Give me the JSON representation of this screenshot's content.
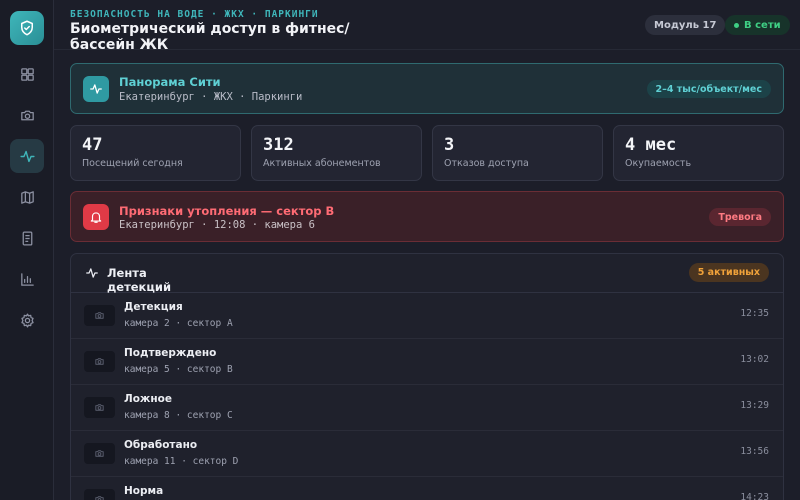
{
  "header": {
    "eyebrow": "БЕЗОПАСНОСТЬ НА ВОДЕ · ЖКХ · ПАРКИНГИ",
    "title": "Биометрический доступ в фитнес/бассейн ЖК",
    "module": "Модуль 17",
    "status": "В сети"
  },
  "sidebar": {
    "logo_icon": "shield-check-icon",
    "items": [
      {
        "icon": "dashboard-grid-icon",
        "active": false
      },
      {
        "icon": "camera-icon",
        "active": false
      },
      {
        "icon": "pulse-icon",
        "active": true
      },
      {
        "icon": "map-icon",
        "active": false
      },
      {
        "icon": "document-icon",
        "active": false
      },
      {
        "icon": "bar-chart-icon",
        "active": false
      },
      {
        "icon": "gear-icon",
        "active": false
      }
    ]
  },
  "site": {
    "name": "Панорама Сити",
    "meta": "Екатеринбург · ЖКХ · Паркинги",
    "price": "2–4 тыс/объект/мес"
  },
  "stats": [
    {
      "value": "47",
      "label": "Посещений сегодня"
    },
    {
      "value": "312",
      "label": "Активных абонементов"
    },
    {
      "value": "3",
      "label": "Отказов доступа"
    },
    {
      "value": "4 мес",
      "label": "Окупаемость"
    }
  ],
  "alert": {
    "title": "Признаки утопления — сектор B",
    "meta": "Екатеринбург · 12:08 · камера 6",
    "badge": "Тревога"
  },
  "feed": {
    "title": "Лента детекций",
    "count": "5 активных",
    "items": [
      {
        "status": "Детекция",
        "meta": "камера 2 · сектор A",
        "time": "12:35"
      },
      {
        "status": "Подтверждено",
        "meta": "камера 5 · сектор B",
        "time": "13:02"
      },
      {
        "status": "Ложное",
        "meta": "камера 8 · сектор C",
        "time": "13:29"
      },
      {
        "status": "Обработано",
        "meta": "камера 11 · сектор D",
        "time": "13:56"
      },
      {
        "status": "Норма",
        "meta": "",
        "time": "14:23"
      }
    ]
  },
  "colors": {
    "accent": "#3fb6ba",
    "danger": "#e03a46",
    "warning": "#f0a23a",
    "success": "#3fcf84"
  }
}
